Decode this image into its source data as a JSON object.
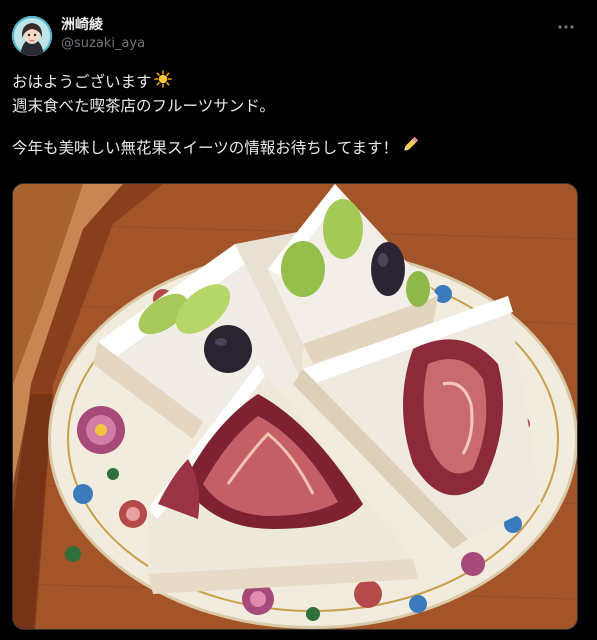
{
  "author": {
    "display_name": "洲崎綾",
    "handle": "@suzaki_aya"
  },
  "more_icon": "more-horizontal-icon",
  "tweet_text": {
    "line1": "おはようございます",
    "line1_emoji": "sun-icon",
    "line2": "週末食べた喫茶店のフルーツサンド。",
    "line3": "今年も美味しい無花果スイーツの情報お待ちしてます！",
    "line3_emoji": "pencil-icon"
  },
  "media": {
    "subject": "fruit-sandwich-photo"
  },
  "colors": {
    "background": "#000000",
    "text": "#e7e9ea",
    "secondary_text": "#71767b"
  }
}
